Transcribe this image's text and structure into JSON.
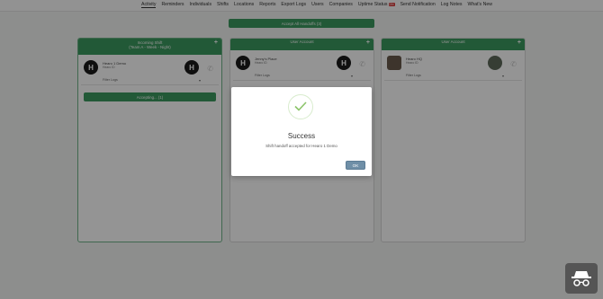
{
  "nav": {
    "items": [
      {
        "label": "Activity",
        "active": true
      },
      {
        "label": "Reminders"
      },
      {
        "label": "Individuals"
      },
      {
        "label": "Shifts"
      },
      {
        "label": "Locations"
      },
      {
        "label": "Reports"
      },
      {
        "label": "Export Logs"
      },
      {
        "label": "Users"
      },
      {
        "label": "Companies"
      },
      {
        "label": "Uptime Status",
        "badge": "DN"
      },
      {
        "label": "Send Notification"
      },
      {
        "label": "Log Notes"
      },
      {
        "label": "What's New"
      }
    ]
  },
  "accept_all_label": "Accept All Handoffs (3)",
  "columns": [
    {
      "header_line1": "Incoming Shift",
      "header_line2": "(Team A - Week - Night)",
      "person_name": "Hearo 1 Demo",
      "person_sub": "Hearo ID",
      "filter": "Filter Logs",
      "accepting_label": "Accepting... (1)"
    },
    {
      "header_line1": "User Account",
      "person_name": "Jenny's Place",
      "person_sub": "Hearo ID",
      "filter": "Filter Logs"
    },
    {
      "header_line1": "User Account",
      "person_name": "Hearo HQ",
      "person_sub": "Hearo ID",
      "filter": "Filter Logs"
    }
  ],
  "modal": {
    "title": "Success",
    "message": "Shift handoff accepted for Hearo 1 Demo",
    "ok_label": "OK"
  },
  "colors": {
    "accent": "#3c9a5f",
    "ok_button": "#6f8fa7"
  },
  "icons": [
    "check-icon",
    "plus-icon",
    "phone-icon",
    "chevron-down-icon",
    "incognito-icon"
  ]
}
